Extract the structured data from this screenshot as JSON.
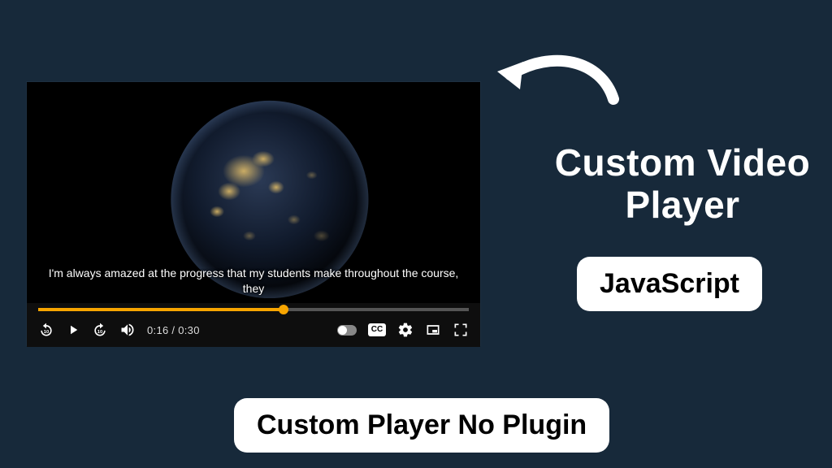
{
  "player": {
    "caption": "I'm always amazed at the progress that my students make throughout the course, they",
    "time_current": "0:16",
    "time_total": "0:30",
    "time_display": "0:16 / 0:30",
    "progress_pct": 57,
    "rewind_seconds": "10",
    "forward_seconds": "10",
    "cc_label": "CC",
    "autoplay_on": false
  },
  "labels": {
    "headline": "Custom Video Player",
    "tag_js": "JavaScript",
    "tag_bottom": "Custom Player No Plugin"
  }
}
